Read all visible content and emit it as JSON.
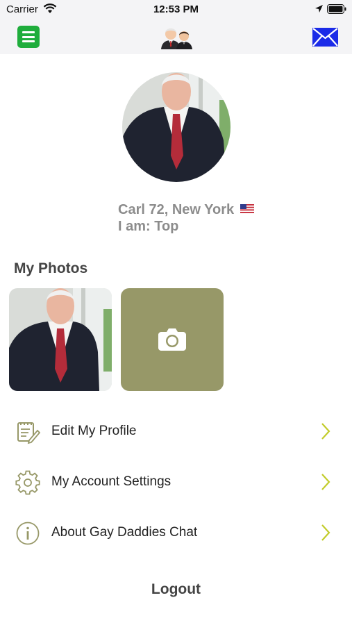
{
  "status_bar": {
    "carrier": "Carrier",
    "time": "12:53 PM"
  },
  "nav": {
    "menu_icon": "hamburger-menu-icon",
    "logo_icon": "two-men-logo-icon",
    "mail_icon": "envelope-icon"
  },
  "profile": {
    "name_line": "Carl 72, New York",
    "flag_icon": "us-flag-icon",
    "role_line": "I am: Top"
  },
  "photos": {
    "title": "My Photos",
    "add_photo_icon": "camera-icon"
  },
  "menu": [
    {
      "label": "Edit My Profile",
      "icon": "notepad-edit-icon"
    },
    {
      "label": "My Account Settings",
      "icon": "gear-icon"
    },
    {
      "label": "About Gay Daddies Chat",
      "icon": "info-icon"
    }
  ],
  "logout_label": "Logout",
  "colors": {
    "menu_green": "#1fad3c",
    "mail_blue": "#1b2be8",
    "olive": "#979868",
    "chevron": "#c2cc2a",
    "muted_text": "#8c8c8c"
  }
}
